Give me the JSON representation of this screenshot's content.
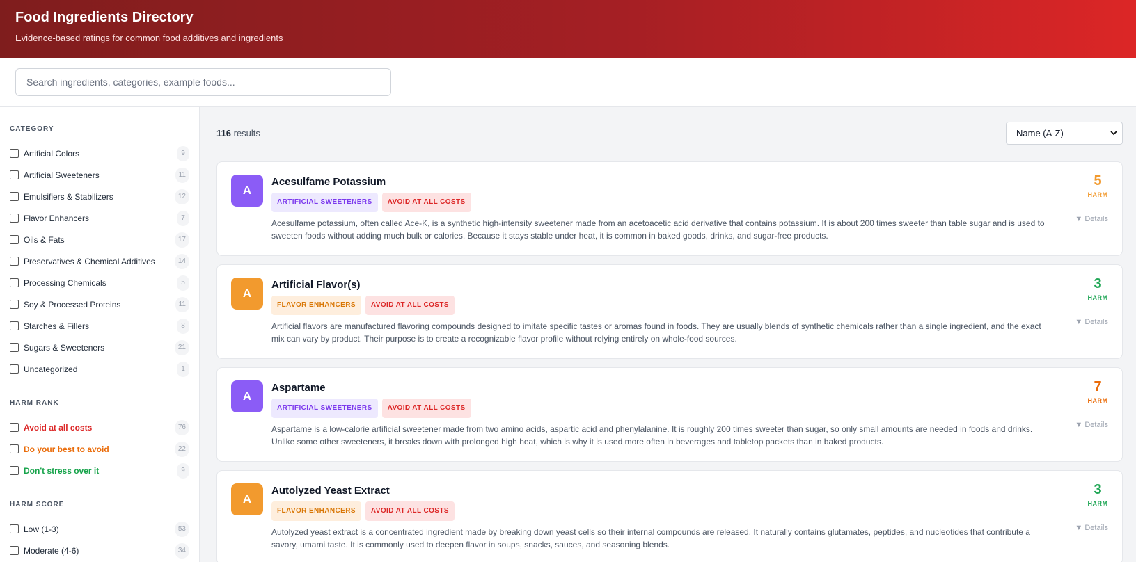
{
  "header": {
    "title": "Food Ingredients Directory",
    "subtitle": "Evidence-based ratings for common food additives and ingredients"
  },
  "search": {
    "placeholder": "Search ingredients, categories, example foods..."
  },
  "sidebar": {
    "category": {
      "title": "CATEGORY",
      "items": [
        {
          "label": "Artificial Colors",
          "count": "9"
        },
        {
          "label": "Artificial Sweeteners",
          "count": "11"
        },
        {
          "label": "Emulsifiers & Stabilizers",
          "count": "12"
        },
        {
          "label": "Flavor Enhancers",
          "count": "7"
        },
        {
          "label": "Oils & Fats",
          "count": "17"
        },
        {
          "label": "Preservatives & Chemical Additives",
          "count": "14"
        },
        {
          "label": "Processing Chemicals",
          "count": "5"
        },
        {
          "label": "Soy & Processed Proteins",
          "count": "11"
        },
        {
          "label": "Starches & Fillers",
          "count": "8"
        },
        {
          "label": "Sugars & Sweeteners",
          "count": "21"
        },
        {
          "label": "Uncategorized",
          "count": "1"
        }
      ]
    },
    "harm_rank": {
      "title": "HARM RANK",
      "items": [
        {
          "label": "Avoid at all costs",
          "count": "76",
          "color": "#dc2626"
        },
        {
          "label": "Do your best to avoid",
          "count": "22",
          "color": "#ea6c0a"
        },
        {
          "label": "Don't stress over it",
          "count": "9",
          "color": "#16a34a"
        }
      ]
    },
    "harm_score": {
      "title": "HARM SCORE",
      "items": [
        {
          "label": "Low (1-3)",
          "count": "53"
        },
        {
          "label": "Moderate (4-6)",
          "count": "34"
        }
      ]
    }
  },
  "main": {
    "results_count": "116",
    "results_label": "results",
    "sort_value": "Name (A-Z)",
    "details_label": "▼ Details",
    "harm_label": "HARM",
    "cards": [
      {
        "letter": "A",
        "title": "Acesulfame Potassium",
        "category_tag": "ARTIFICIAL SWEETENERS",
        "rank_tag": "AVOID AT ALL COSTS",
        "score": "5",
        "description": "Acesulfame potassium, often called Ace-K, is a synthetic high-intensity sweetener made from an acetoacetic acid derivative that contains potassium. It is about 200 times sweeter than table sugar and is used to sweeten foods without adding much bulk or calories. Because it stays stable under heat, it is common in baked goods, drinks, and sugar-free products."
      },
      {
        "letter": "A",
        "title": "Artificial Flavor(s)",
        "category_tag": "FLAVOR ENHANCERS",
        "rank_tag": "AVOID AT ALL COSTS",
        "score": "3",
        "description": "Artificial flavors are manufactured flavoring compounds designed to imitate specific tastes or aromas found in foods. They are usually blends of synthetic chemicals rather than a single ingredient, and the exact mix can vary by product. Their purpose is to create a recognizable flavor profile without relying entirely on whole-food sources."
      },
      {
        "letter": "A",
        "title": "Aspartame",
        "category_tag": "ARTIFICIAL SWEETENERS",
        "rank_tag": "AVOID AT ALL COSTS",
        "score": "7",
        "description": "Aspartame is a low-calorie artificial sweetener made from two amino acids, aspartic acid and phenylalanine. It is roughly 200 times sweeter than sugar, so only small amounts are needed in foods and drinks. Unlike some other sweeteners, it breaks down with prolonged high heat, which is why it is used more often in beverages and tabletop packets than in baked products."
      },
      {
        "letter": "A",
        "title": "Autolyzed Yeast Extract",
        "category_tag": "FLAVOR ENHANCERS",
        "rank_tag": "AVOID AT ALL COSTS",
        "score": "3",
        "description": "Autolyzed yeast extract is a concentrated ingredient made by breaking down yeast cells so their internal compounds are released. It naturally contains glutamates, peptides, and nucleotides that contribute a savory, umami taste. It is commonly used to deepen flavor in soups, snacks, sauces, and seasoning blends."
      }
    ]
  }
}
